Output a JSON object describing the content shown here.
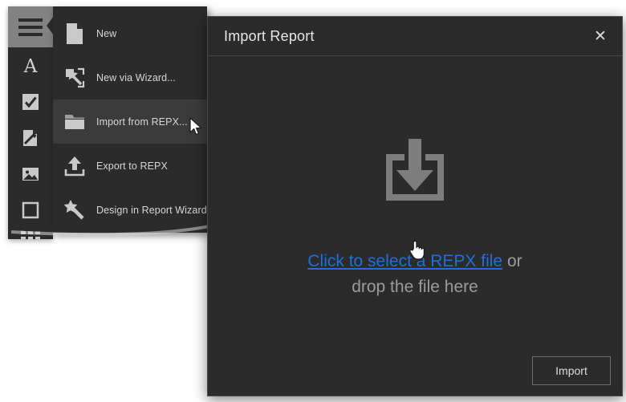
{
  "toolbar": {
    "menu_button": "menu-hamburger",
    "items": [
      {
        "name": "label-tool",
        "icon": "letter-a-icon"
      },
      {
        "name": "checkbox-tool",
        "icon": "checkbox-icon"
      },
      {
        "name": "rich-text-tool",
        "icon": "rich-text-icon"
      },
      {
        "name": "picture-tool",
        "icon": "picture-icon"
      },
      {
        "name": "panel-tool",
        "icon": "panel-icon"
      },
      {
        "name": "table-tool",
        "icon": "table-grid-icon"
      }
    ]
  },
  "menu": {
    "items": [
      {
        "label": "New",
        "icon": "page-icon",
        "active": false
      },
      {
        "label": "New via Wizard...",
        "icon": "wand-page-icon",
        "active": false
      },
      {
        "label": "Import from REPX...",
        "icon": "folder-icon",
        "active": true
      },
      {
        "label": "Export to REPX",
        "icon": "upload-icon",
        "active": false
      },
      {
        "label": "Design in Report Wizard...",
        "icon": "magic-wand-icon",
        "active": false
      }
    ]
  },
  "dialog": {
    "title": "Import Report",
    "close_label": "✕",
    "drop_zone": {
      "icon": "download-tray-icon",
      "link_text": "Click to select a REPX file",
      "or_text": " or",
      "second_line": "drop the file here"
    },
    "footer": {
      "import_label": "Import"
    }
  },
  "colors": {
    "panel_bg": "#2b2b2b",
    "panel_active": "#3b3b3b",
    "menu_button_bg": "#828282",
    "link": "#1f6fdd",
    "muted_text": "#9b9b9b",
    "body_text": "#d6d6d6",
    "border": "#4a4a4a",
    "canvas": "#ffffff"
  }
}
